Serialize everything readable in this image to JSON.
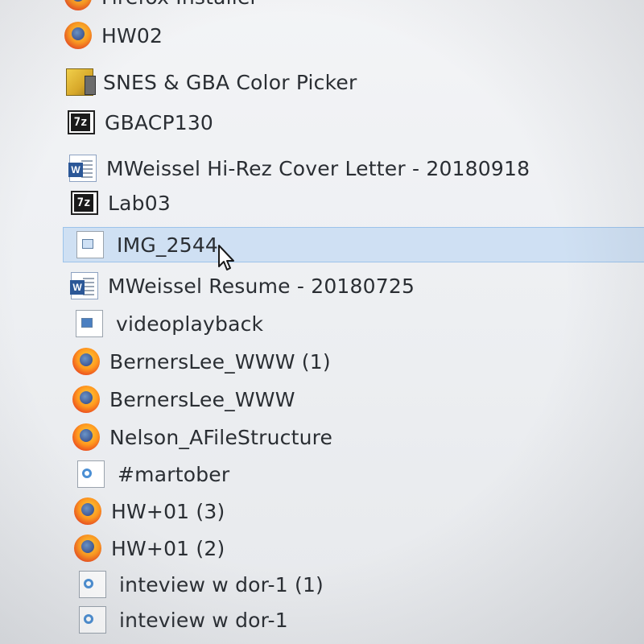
{
  "file_list": {
    "items": [
      {
        "label": "Firefox Installer",
        "icon": "firefox-icon",
        "selected": false
      },
      {
        "label": "HW02",
        "icon": "firefox-icon",
        "selected": false
      },
      {
        "label": "SNES & GBA Color Picker",
        "icon": "snes-app-icon",
        "selected": false
      },
      {
        "label": "GBACP130",
        "icon": "7z-archive-icon",
        "selected": false
      },
      {
        "label": "MWeissel Hi-Rez Cover Letter - 20180918",
        "icon": "word-document-icon",
        "selected": false
      },
      {
        "label": "Lab03",
        "icon": "7z-archive-icon",
        "selected": false
      },
      {
        "label": "IMG_2544",
        "icon": "image-file-icon",
        "selected": true
      },
      {
        "label": "MWeissel Resume - 20180725",
        "icon": "word-document-icon",
        "selected": false
      },
      {
        "label": "videoplayback",
        "icon": "video-file-icon",
        "selected": false
      },
      {
        "label": "BernersLee_WWW (1)",
        "icon": "firefox-icon",
        "selected": false
      },
      {
        "label": "BernersLee_WWW",
        "icon": "firefox-icon",
        "selected": false
      },
      {
        "label": "Nelson_AFileStructure",
        "icon": "firefox-icon",
        "selected": false
      },
      {
        "label": "#martober",
        "icon": "media-file-icon",
        "selected": false
      },
      {
        "label": "HW+01 (3)",
        "icon": "firefox-icon",
        "selected": false
      },
      {
        "label": "HW+01 (2)",
        "icon": "firefox-icon",
        "selected": false
      },
      {
        "label": "inteview w dor-1 (1)",
        "icon": "media-file-icon",
        "selected": false
      },
      {
        "label": "inteview w dor-1",
        "icon": "media-file-icon",
        "selected": false
      }
    ]
  },
  "colors": {
    "selection_background": "#cfe0f3",
    "selection_border": "#9cc3ea",
    "text": "#2a2e33"
  }
}
